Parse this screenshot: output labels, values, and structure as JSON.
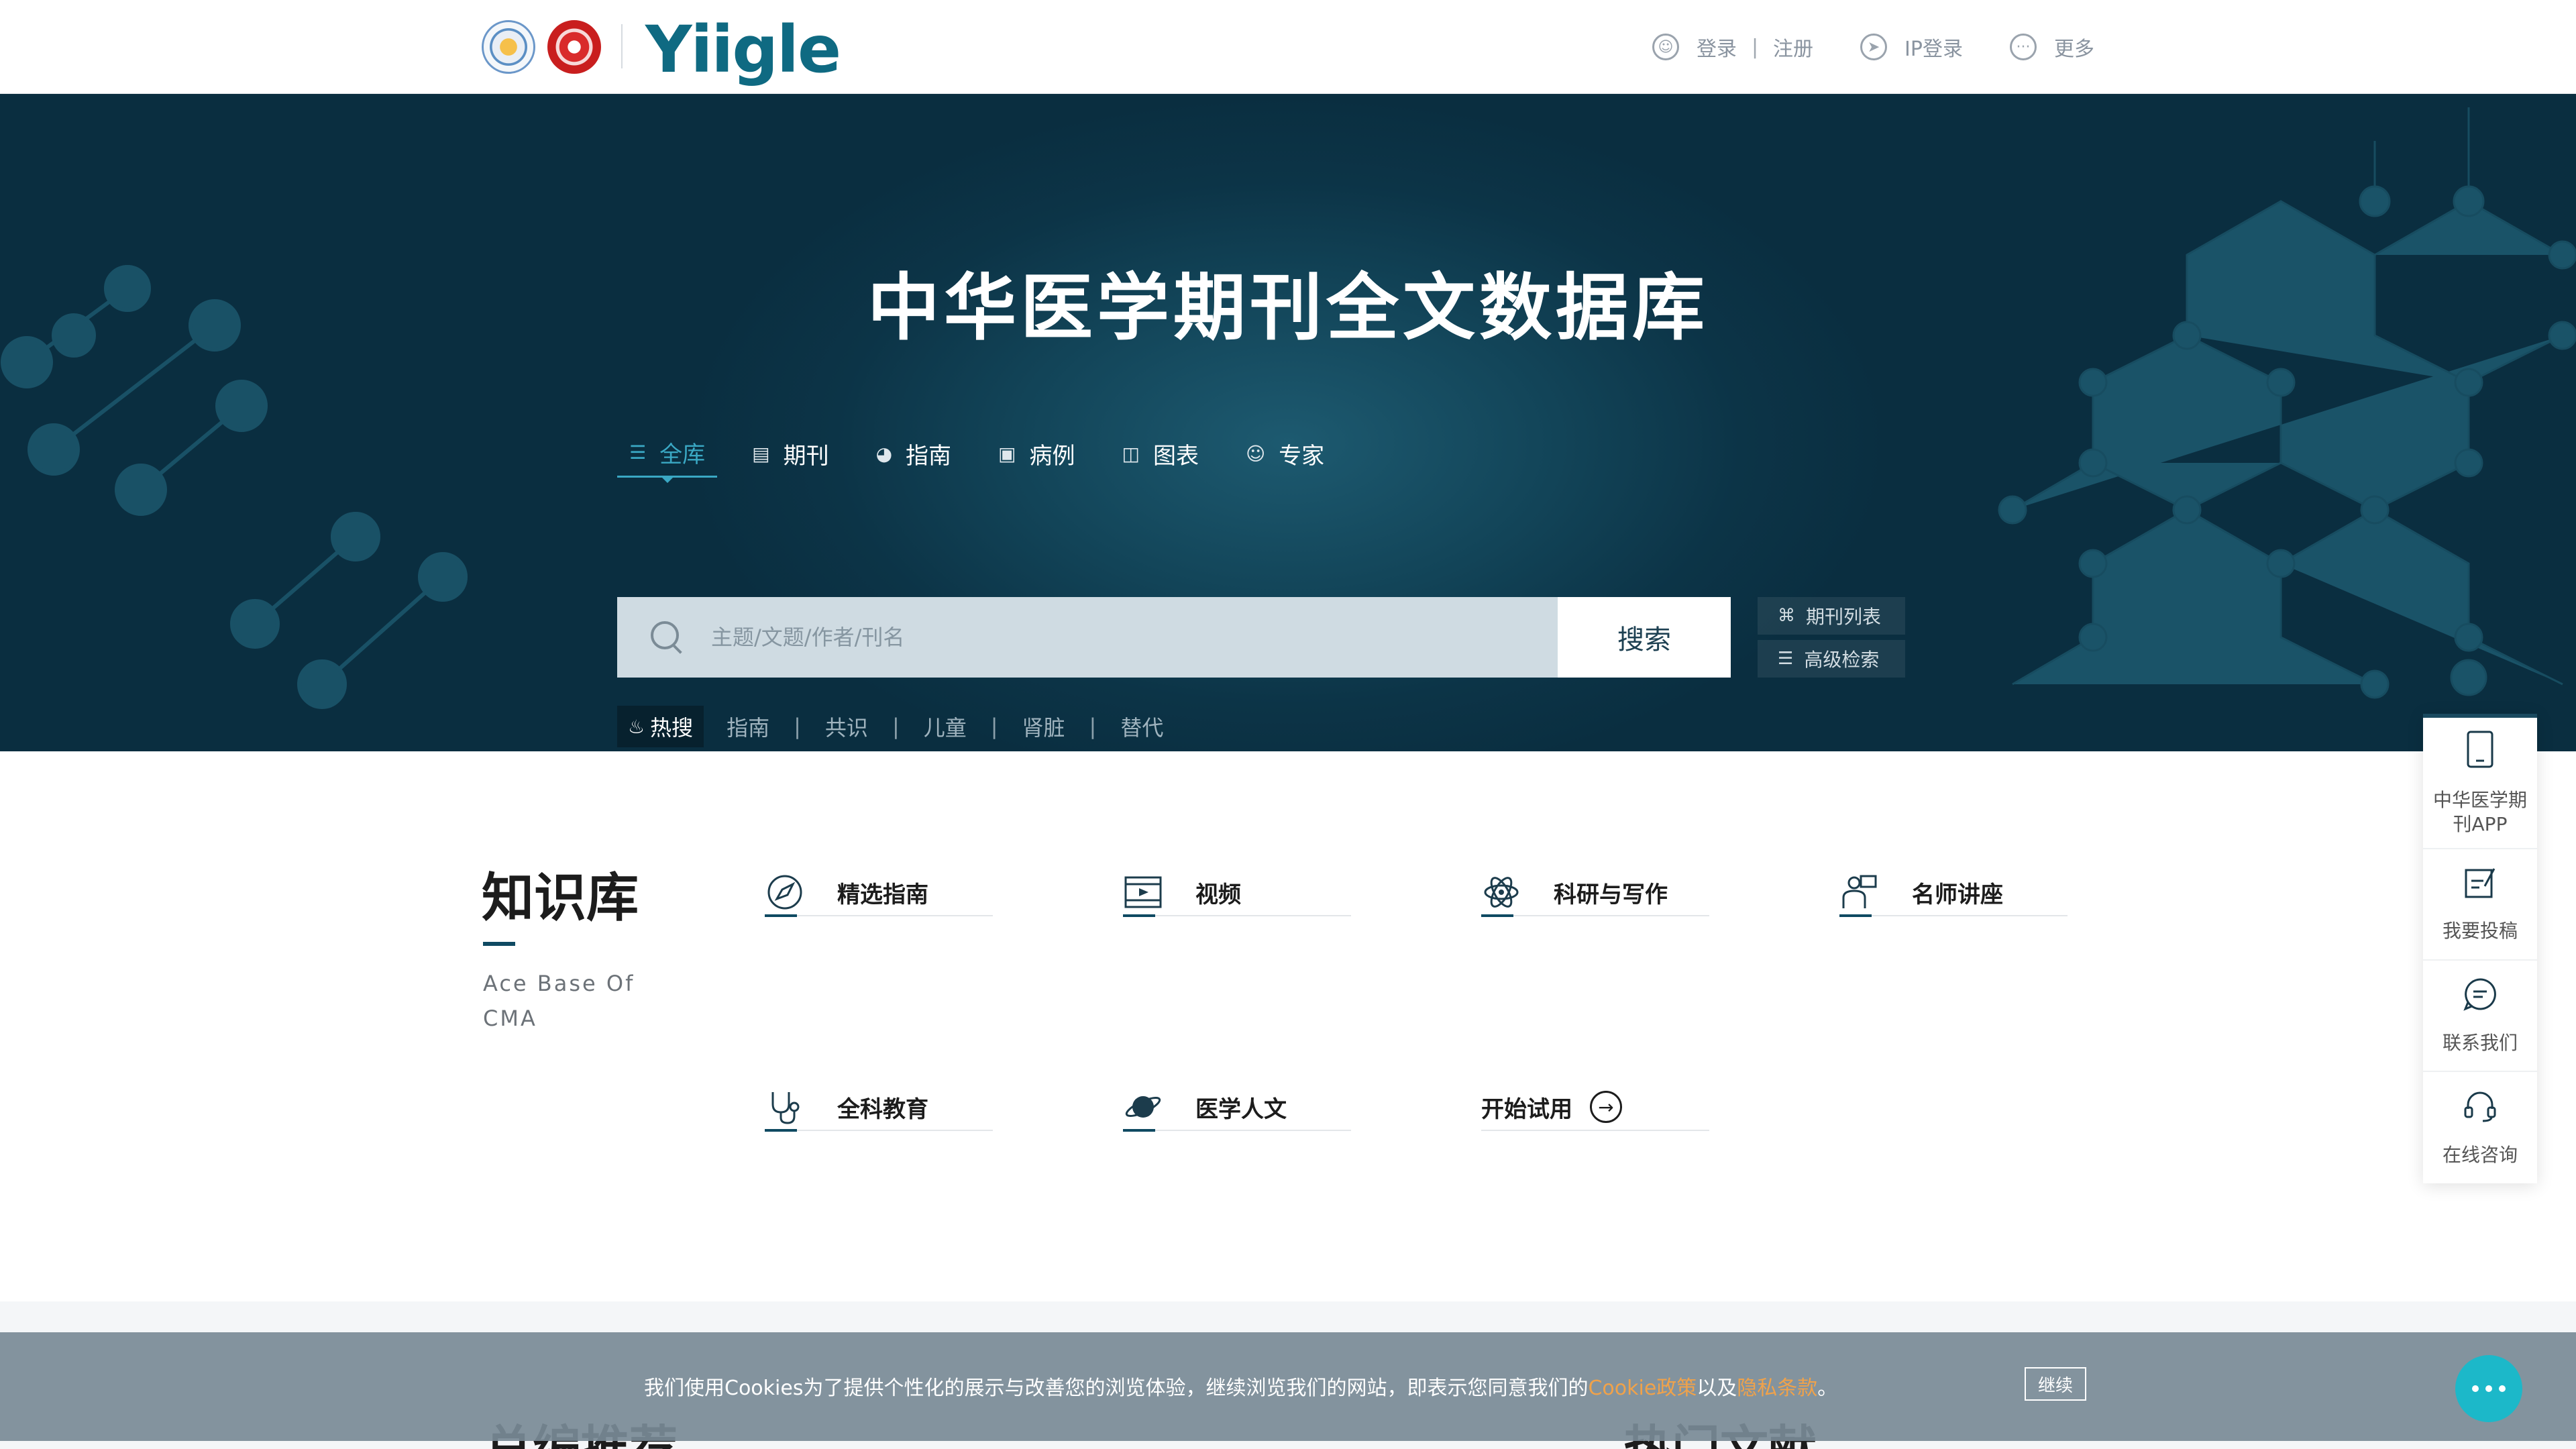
{
  "header": {
    "brand": "Yiigle",
    "links": [
      {
        "icon": "user-icon",
        "label": "登录"
      },
      {
        "label": "注册"
      },
      {
        "icon": "send-icon",
        "label": "IP登录"
      },
      {
        "icon": "more-icon",
        "label": "更多"
      }
    ],
    "separator": "|"
  },
  "hero": {
    "title": "中华医学期刊全文数据库",
    "tabs": [
      {
        "icon": "layers-icon",
        "label": "全库",
        "active": true
      },
      {
        "icon": "document-icon",
        "label": "期刊"
      },
      {
        "icon": "compass-icon",
        "label": "指南"
      },
      {
        "icon": "case-icon",
        "label": "病例"
      },
      {
        "icon": "chart-icon",
        "label": "图表"
      },
      {
        "icon": "person-icon",
        "label": "专家"
      }
    ],
    "search": {
      "placeholder": "主题/文题/作者/刊名",
      "value": "",
      "button": "搜索"
    },
    "side_links": [
      {
        "icon": "grid-icon",
        "label": "期刊列表"
      },
      {
        "icon": "advanced-search-icon",
        "label": "高级检索"
      }
    ],
    "hot": {
      "tag": "热搜",
      "items": [
        "指南",
        "共识",
        "儿童",
        "肾脏",
        "替代"
      ],
      "separator": "|"
    }
  },
  "knowledge": {
    "title": "知识库",
    "subtitle": "Ace Base Of CMA",
    "cards": [
      {
        "icon": "compass-icon",
        "label": "精选指南"
      },
      {
        "icon": "film-icon",
        "label": "视频"
      },
      {
        "icon": "atom-icon",
        "label": "科研与写作"
      },
      {
        "icon": "lecturer-icon",
        "label": "名师讲座"
      },
      {
        "icon": "stethoscope-icon",
        "label": "全科教育"
      },
      {
        "icon": "planet-icon",
        "label": "医学人文"
      },
      {
        "label": "开始试用"
      }
    ]
  },
  "float_panel": [
    {
      "icon": "tablet-icon",
      "label": "中华医学期刊APP"
    },
    {
      "icon": "edit-icon",
      "label": "我要投稿"
    },
    {
      "icon": "chat-icon",
      "label": "联系我们"
    },
    {
      "icon": "headset-icon",
      "label": "在线咨询"
    }
  ],
  "lower": {
    "left_title": "总编推荐",
    "right_title": "热门文献"
  },
  "cookie": {
    "text_before": "我们使用Cookies为了提供个性化的展示与改善您的浏览体验，继续浏览我们的网站，即表示您同意我们的",
    "cookie_policy": "Cookie政策",
    "conj": "以及",
    "privacy": "隐私条款",
    "end": "。",
    "button": "继续"
  },
  "colors": {
    "brand": "#0f6a82",
    "hero_bg": "#0c3447",
    "accent": "#3aa8c4",
    "link_orange": "#f0a24a"
  }
}
